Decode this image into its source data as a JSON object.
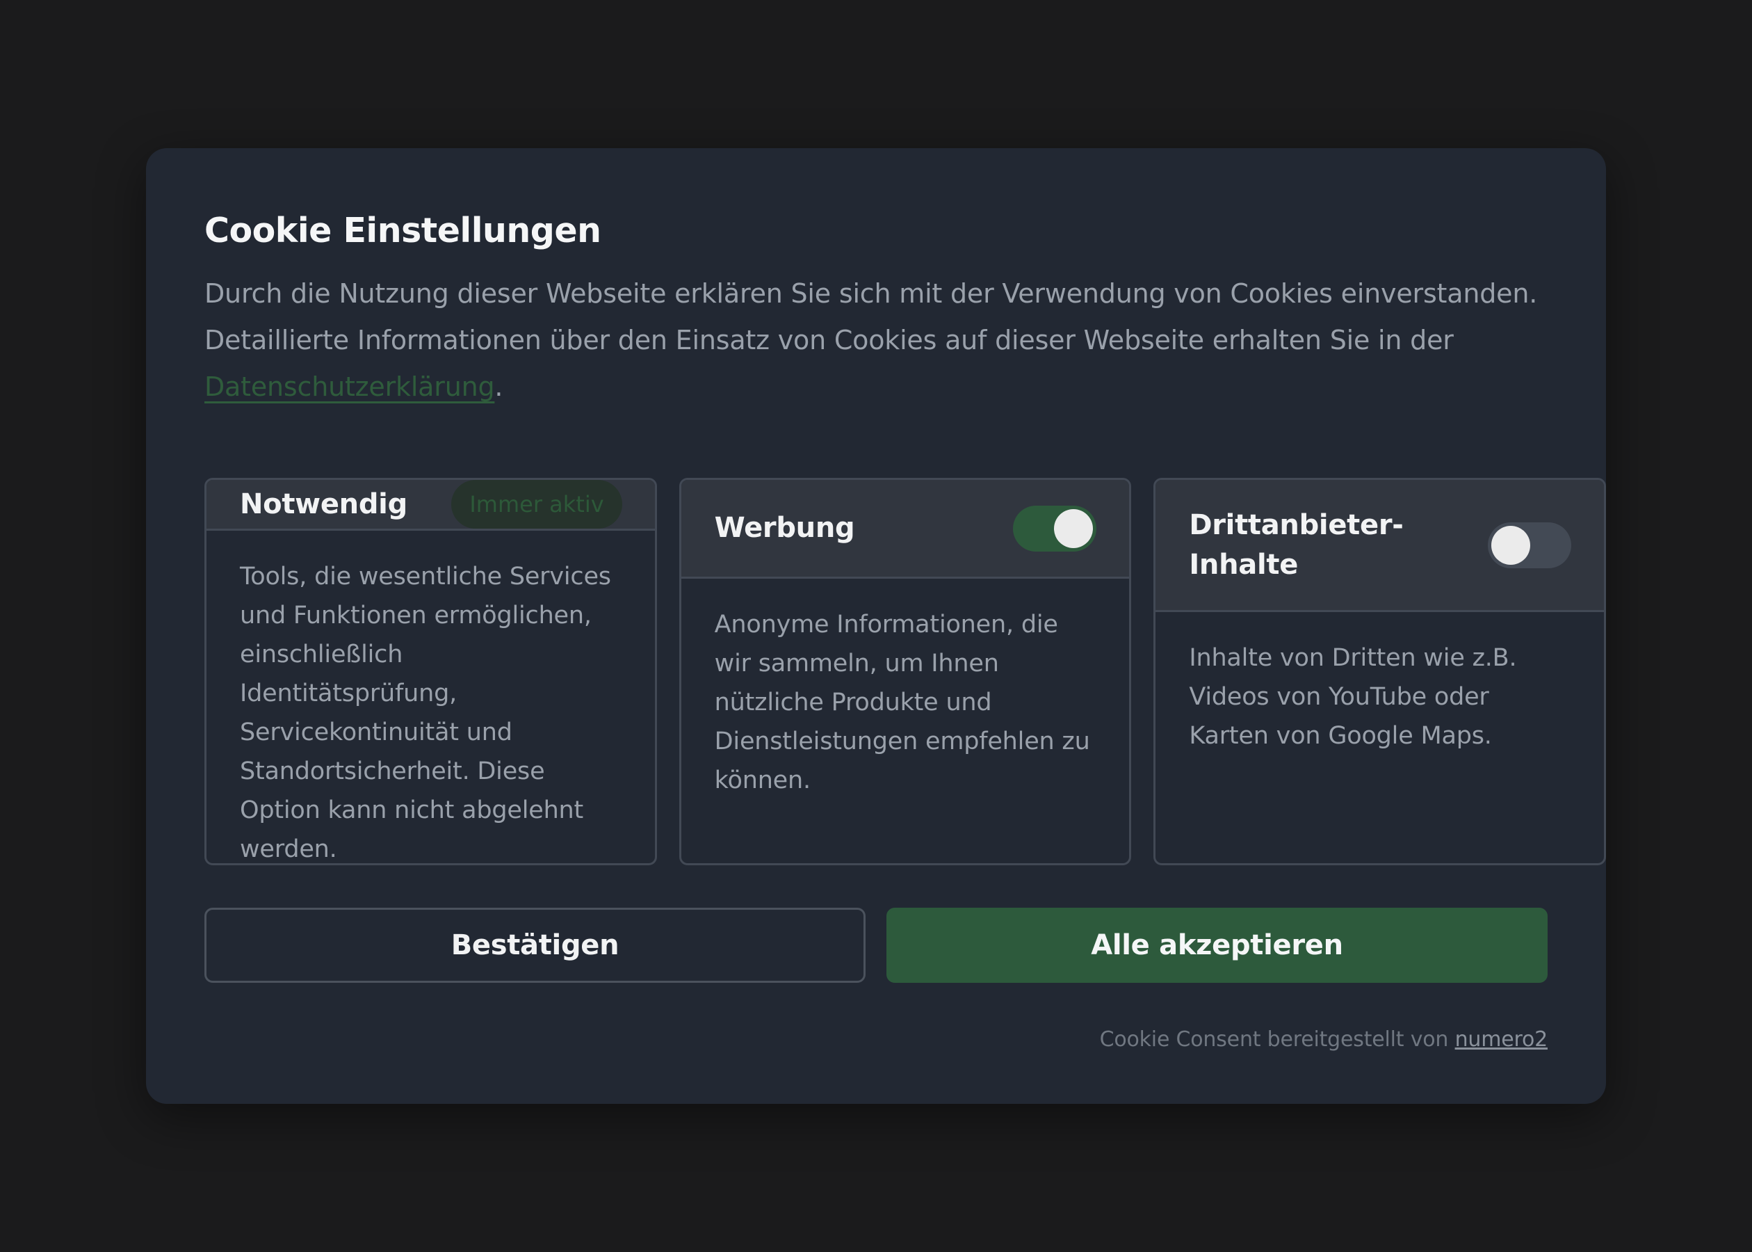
{
  "modal": {
    "title": "Cookie Einstellungen",
    "intro_text": "Durch die Nutzung dieser Webseite erklären Sie sich mit der Verwendung von Cookies einverstanden. Detaillierte Informationen über den Einsatz von Cookies auf dieser Webseite erhalten Sie in der ",
    "privacy_link": "Datenschutzerklärung",
    "intro_end": "."
  },
  "categories": [
    {
      "title": "Notwendig",
      "badge": "Immer aktiv",
      "description": "Tools, die wesentliche Services und Funktionen ermöglichen, einschließlich Identitätsprüfung, Servicekontinuität und Standortsicherheit. Diese Option kann nicht abgelehnt werden."
    },
    {
      "title": "Werbung",
      "enabled": true,
      "description": "Anonyme Informationen, die wir sammeln, um Ihnen nützliche Produkte und Dienstleistungen empfehlen zu können."
    },
    {
      "title": "Drittanbieter-Inhalte",
      "enabled": false,
      "description": "Inhalte von Dritten wie z.B. Videos von YouTube oder Karten von Google Maps."
    }
  ],
  "buttons": {
    "confirm": "Bestätigen",
    "accept_all": "Alle akzeptieren"
  },
  "footer": {
    "text": "Cookie Consent bereitgestellt von ",
    "link": "numero2"
  },
  "colors": {
    "background": "#1b1b1c",
    "modal": "#222833",
    "accent_green": "#2d5a3c",
    "toggle_off": "#434a55"
  }
}
